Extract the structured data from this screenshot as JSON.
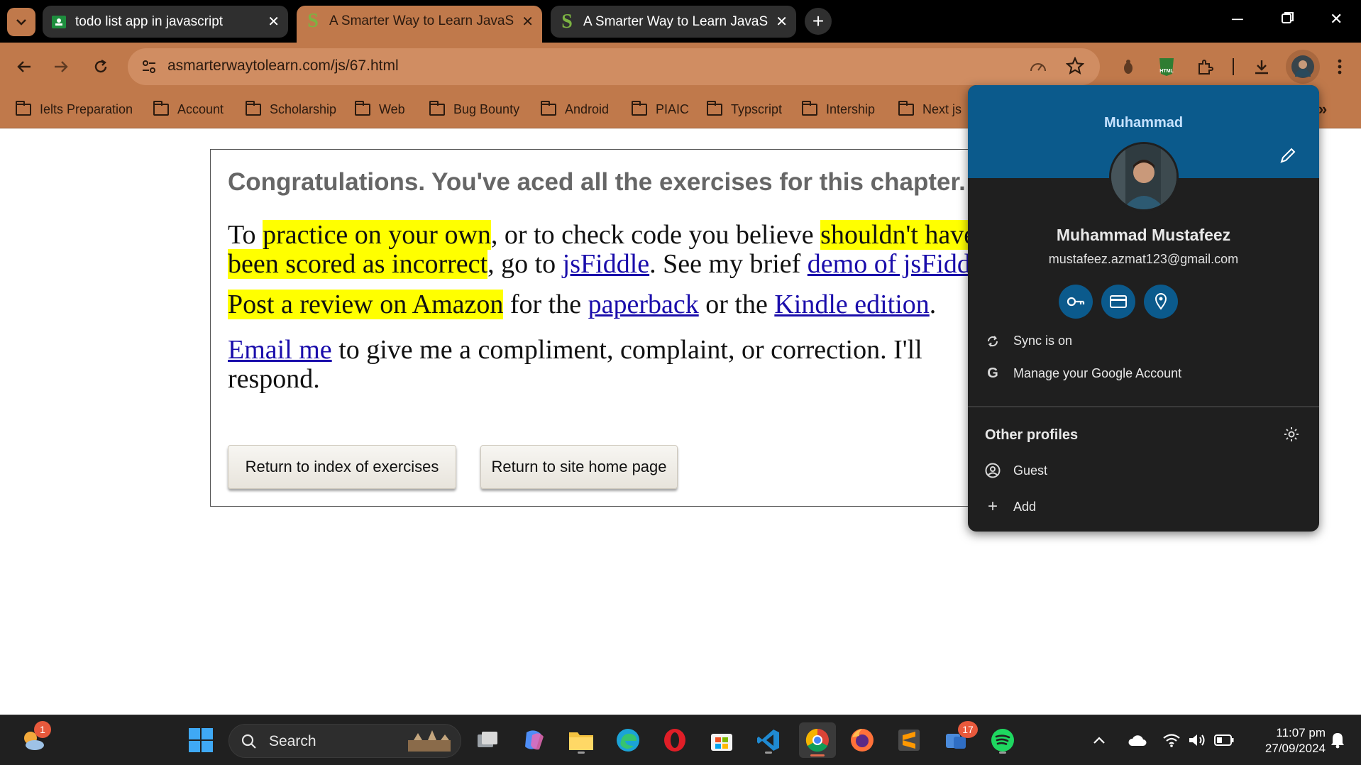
{
  "tabs": [
    {
      "title": "todo list app in javascript",
      "icon": "google-classroom-icon"
    },
    {
      "title": "A Smarter Way to Learn JavaScr",
      "icon": "smarter-way-icon"
    },
    {
      "title": "A Smarter Way to Learn JavaScr",
      "icon": "smarter-way-icon"
    }
  ],
  "toolbar": {
    "url": "asmarterwaytolearn.com/js/67.html"
  },
  "bookmarks": [
    "Ielts Preparation",
    "Account",
    "Scholarship",
    "Web",
    "Bug Bounty",
    "Android",
    "PIAIC",
    "Typscript",
    "Intership",
    "Next js"
  ],
  "page": {
    "congrats": "Congratulations. You've aced all the exercises for this chapter.",
    "p1": {
      "t1": "To ",
      "h1": "practice on your own",
      "t2": ", or to check code you believe ",
      "h2": "shouldn't have",
      "h3": "been scored as incorrect",
      "t3": ", go to ",
      "l1": "jsFiddle",
      "t4": ". See my brief ",
      "l2": "demo of jsFiddle"
    },
    "p2": {
      "h1": "Post a review on Amazon",
      "t1": " for the ",
      "l1": "paperback",
      "t2": " or the ",
      "l2": "Kindle edition",
      "t3": "."
    },
    "p3": {
      "l1": "Email me",
      "t1": " to give me a compliment, complaint, or correction. I'll",
      "t2": "respond."
    },
    "buttons": {
      "index": "Return to index of exercises",
      "home": "Return to site home page"
    }
  },
  "profile": {
    "greeting": "Muhammad",
    "name": "Muhammad Mustafeez",
    "email": "mustafeez.azmat123@gmail.com",
    "sync": "Sync is on",
    "manage": "Manage your Google Account",
    "other_profiles": "Other profiles",
    "guest": "Guest",
    "add": "Add"
  },
  "taskbar": {
    "search_placeholder": "Search",
    "weather_badge": "1",
    "teams_badge": "17",
    "time": "11:07 pm",
    "date": "27/09/2024"
  },
  "colors": {
    "accent": "#c0794b",
    "profile_header": "#0b5a8c",
    "highlight": "#ffff00",
    "link": "#1a0dab"
  }
}
